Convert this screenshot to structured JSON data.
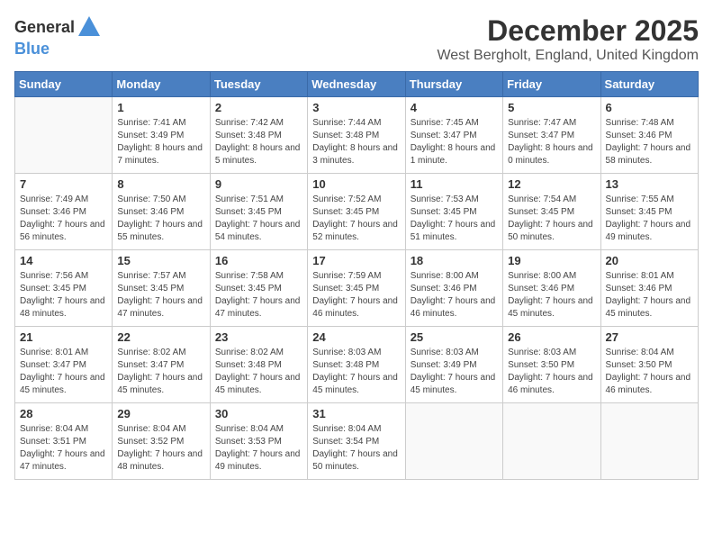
{
  "header": {
    "logo_general": "General",
    "logo_blue": "Blue",
    "month": "December 2025",
    "location": "West Bergholt, England, United Kingdom"
  },
  "weekdays": [
    "Sunday",
    "Monday",
    "Tuesday",
    "Wednesday",
    "Thursday",
    "Friday",
    "Saturday"
  ],
  "weeks": [
    [
      {
        "day": "",
        "sunrise": "",
        "sunset": "",
        "daylight": ""
      },
      {
        "day": "1",
        "sunrise": "Sunrise: 7:41 AM",
        "sunset": "Sunset: 3:49 PM",
        "daylight": "Daylight: 8 hours and 7 minutes."
      },
      {
        "day": "2",
        "sunrise": "Sunrise: 7:42 AM",
        "sunset": "Sunset: 3:48 PM",
        "daylight": "Daylight: 8 hours and 5 minutes."
      },
      {
        "day": "3",
        "sunrise": "Sunrise: 7:44 AM",
        "sunset": "Sunset: 3:48 PM",
        "daylight": "Daylight: 8 hours and 3 minutes."
      },
      {
        "day": "4",
        "sunrise": "Sunrise: 7:45 AM",
        "sunset": "Sunset: 3:47 PM",
        "daylight": "Daylight: 8 hours and 1 minute."
      },
      {
        "day": "5",
        "sunrise": "Sunrise: 7:47 AM",
        "sunset": "Sunset: 3:47 PM",
        "daylight": "Daylight: 8 hours and 0 minutes."
      },
      {
        "day": "6",
        "sunrise": "Sunrise: 7:48 AM",
        "sunset": "Sunset: 3:46 PM",
        "daylight": "Daylight: 7 hours and 58 minutes."
      }
    ],
    [
      {
        "day": "7",
        "sunrise": "Sunrise: 7:49 AM",
        "sunset": "Sunset: 3:46 PM",
        "daylight": "Daylight: 7 hours and 56 minutes."
      },
      {
        "day": "8",
        "sunrise": "Sunrise: 7:50 AM",
        "sunset": "Sunset: 3:46 PM",
        "daylight": "Daylight: 7 hours and 55 minutes."
      },
      {
        "day": "9",
        "sunrise": "Sunrise: 7:51 AM",
        "sunset": "Sunset: 3:45 PM",
        "daylight": "Daylight: 7 hours and 54 minutes."
      },
      {
        "day": "10",
        "sunrise": "Sunrise: 7:52 AM",
        "sunset": "Sunset: 3:45 PM",
        "daylight": "Daylight: 7 hours and 52 minutes."
      },
      {
        "day": "11",
        "sunrise": "Sunrise: 7:53 AM",
        "sunset": "Sunset: 3:45 PM",
        "daylight": "Daylight: 7 hours and 51 minutes."
      },
      {
        "day": "12",
        "sunrise": "Sunrise: 7:54 AM",
        "sunset": "Sunset: 3:45 PM",
        "daylight": "Daylight: 7 hours and 50 minutes."
      },
      {
        "day": "13",
        "sunrise": "Sunrise: 7:55 AM",
        "sunset": "Sunset: 3:45 PM",
        "daylight": "Daylight: 7 hours and 49 minutes."
      }
    ],
    [
      {
        "day": "14",
        "sunrise": "Sunrise: 7:56 AM",
        "sunset": "Sunset: 3:45 PM",
        "daylight": "Daylight: 7 hours and 48 minutes."
      },
      {
        "day": "15",
        "sunrise": "Sunrise: 7:57 AM",
        "sunset": "Sunset: 3:45 PM",
        "daylight": "Daylight: 7 hours and 47 minutes."
      },
      {
        "day": "16",
        "sunrise": "Sunrise: 7:58 AM",
        "sunset": "Sunset: 3:45 PM",
        "daylight": "Daylight: 7 hours and 47 minutes."
      },
      {
        "day": "17",
        "sunrise": "Sunrise: 7:59 AM",
        "sunset": "Sunset: 3:45 PM",
        "daylight": "Daylight: 7 hours and 46 minutes."
      },
      {
        "day": "18",
        "sunrise": "Sunrise: 8:00 AM",
        "sunset": "Sunset: 3:46 PM",
        "daylight": "Daylight: 7 hours and 46 minutes."
      },
      {
        "day": "19",
        "sunrise": "Sunrise: 8:00 AM",
        "sunset": "Sunset: 3:46 PM",
        "daylight": "Daylight: 7 hours and 45 minutes."
      },
      {
        "day": "20",
        "sunrise": "Sunrise: 8:01 AM",
        "sunset": "Sunset: 3:46 PM",
        "daylight": "Daylight: 7 hours and 45 minutes."
      }
    ],
    [
      {
        "day": "21",
        "sunrise": "Sunrise: 8:01 AM",
        "sunset": "Sunset: 3:47 PM",
        "daylight": "Daylight: 7 hours and 45 minutes."
      },
      {
        "day": "22",
        "sunrise": "Sunrise: 8:02 AM",
        "sunset": "Sunset: 3:47 PM",
        "daylight": "Daylight: 7 hours and 45 minutes."
      },
      {
        "day": "23",
        "sunrise": "Sunrise: 8:02 AM",
        "sunset": "Sunset: 3:48 PM",
        "daylight": "Daylight: 7 hours and 45 minutes."
      },
      {
        "day": "24",
        "sunrise": "Sunrise: 8:03 AM",
        "sunset": "Sunset: 3:48 PM",
        "daylight": "Daylight: 7 hours and 45 minutes."
      },
      {
        "day": "25",
        "sunrise": "Sunrise: 8:03 AM",
        "sunset": "Sunset: 3:49 PM",
        "daylight": "Daylight: 7 hours and 45 minutes."
      },
      {
        "day": "26",
        "sunrise": "Sunrise: 8:03 AM",
        "sunset": "Sunset: 3:50 PM",
        "daylight": "Daylight: 7 hours and 46 minutes."
      },
      {
        "day": "27",
        "sunrise": "Sunrise: 8:04 AM",
        "sunset": "Sunset: 3:50 PM",
        "daylight": "Daylight: 7 hours and 46 minutes."
      }
    ],
    [
      {
        "day": "28",
        "sunrise": "Sunrise: 8:04 AM",
        "sunset": "Sunset: 3:51 PM",
        "daylight": "Daylight: 7 hours and 47 minutes."
      },
      {
        "day": "29",
        "sunrise": "Sunrise: 8:04 AM",
        "sunset": "Sunset: 3:52 PM",
        "daylight": "Daylight: 7 hours and 48 minutes."
      },
      {
        "day": "30",
        "sunrise": "Sunrise: 8:04 AM",
        "sunset": "Sunset: 3:53 PM",
        "daylight": "Daylight: 7 hours and 49 minutes."
      },
      {
        "day": "31",
        "sunrise": "Sunrise: 8:04 AM",
        "sunset": "Sunset: 3:54 PM",
        "daylight": "Daylight: 7 hours and 50 minutes."
      },
      {
        "day": "",
        "sunrise": "",
        "sunset": "",
        "daylight": ""
      },
      {
        "day": "",
        "sunrise": "",
        "sunset": "",
        "daylight": ""
      },
      {
        "day": "",
        "sunrise": "",
        "sunset": "",
        "daylight": ""
      }
    ]
  ]
}
